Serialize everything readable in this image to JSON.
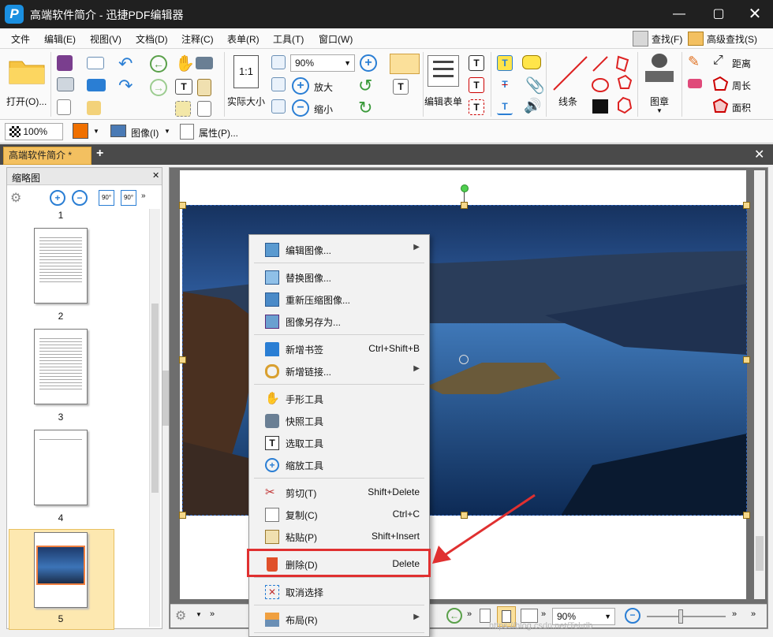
{
  "window": {
    "title": "高端软件简介 - 迅捷PDF编辑器",
    "logo": "P"
  },
  "menubar": {
    "items": [
      "文件",
      "编辑(E)",
      "视图(V)",
      "文档(D)",
      "注释(C)",
      "表单(R)",
      "工具(T)",
      "窗口(W)"
    ],
    "right": [
      "查找(F)",
      "高级查找(S)"
    ]
  },
  "ribbon": {
    "open_label": "打开(O)...",
    "zoom_value": "90%",
    "actual_size_label": "实际大小",
    "actual_size_icon": "1:1",
    "zoom_in_label": "放大",
    "zoom_out_label": "缩小",
    "edit_form_label": "编辑表单",
    "line_label": "线条",
    "stamp_label": "图章",
    "distance_label": "距离",
    "perimeter_label": "周长",
    "area_label": "面积"
  },
  "toolbar2": {
    "opacity_value": "100%",
    "image_label": "图像(I)",
    "props_label": "属性(P)..."
  },
  "tabs": [
    {
      "label": "高端软件简介 *"
    }
  ],
  "thumbnails": {
    "title": "缩略图",
    "page_numbers": [
      "1",
      "2",
      "3",
      "4",
      "5"
    ]
  },
  "context_menu": {
    "items": [
      {
        "label": "编辑图像...",
        "shortcut": "",
        "submenu": true
      },
      {
        "label": "替换图像...",
        "shortcut": ""
      },
      {
        "label": "重新压缩图像...",
        "shortcut": ""
      },
      {
        "label": "图像另存为...",
        "shortcut": ""
      },
      {
        "label": "新增书签",
        "shortcut": "Ctrl+Shift+B"
      },
      {
        "label": "新增链接...",
        "shortcut": "",
        "submenu": true
      },
      {
        "label": "手形工具",
        "shortcut": ""
      },
      {
        "label": "快照工具",
        "shortcut": ""
      },
      {
        "label": "选取工具",
        "shortcut": ""
      },
      {
        "label": "缩放工具",
        "shortcut": ""
      },
      {
        "label": "剪切(T)",
        "shortcut": "Shift+Delete"
      },
      {
        "label": "复制(C)",
        "shortcut": "Ctrl+C"
      },
      {
        "label": "粘贴(P)",
        "shortcut": "Shift+Insert"
      },
      {
        "label": "删除(D)",
        "shortcut": "Delete"
      },
      {
        "label": "取消选择",
        "shortcut": ""
      },
      {
        "label": "布局(R)",
        "shortcut": "",
        "submenu": true
      }
    ]
  },
  "statusbar": {
    "zoom_value": "90%"
  },
  "watermark": "https://blog.csdn.net/Tel-rlb",
  "colors": {
    "highlight_border": "#e03030",
    "tab_active": "#f3c060",
    "selected_thumb": "#fde8b0",
    "accent_blue": "#1a8fe0"
  }
}
